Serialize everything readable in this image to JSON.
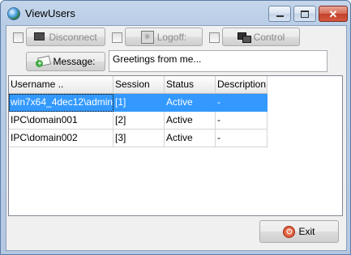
{
  "window": {
    "title": "ViewUsers",
    "close_glyph": "✕"
  },
  "toolbar": {
    "disconnect_label": "Disconnect",
    "logoff_label": "Logoff:",
    "control_label": "Control",
    "message_label": "Message:"
  },
  "message": {
    "value": "Greetings from me..."
  },
  "table": {
    "headers": [
      "Username ..",
      "Session",
      "Status",
      "Description"
    ],
    "rows": [
      [
        "win7x64_4dec12\\admin",
        "[1]",
        "Active",
        "-"
      ],
      [
        "IPC\\domain001",
        "[2]",
        "Active",
        "-"
      ],
      [
        "IPC\\domain002",
        "[3]",
        "Active",
        "-"
      ]
    ],
    "selected_row": 0
  },
  "footer": {
    "exit_label": "Exit"
  },
  "colors": {
    "selection": "#3399ff",
    "close_button": "#c2412a"
  },
  "icons": {
    "app": "globe-icon",
    "disconnect": "disconnect-icon",
    "logoff": "logoff-icon",
    "control": "control-icon",
    "message": "message-icon",
    "exit": "power-icon"
  }
}
